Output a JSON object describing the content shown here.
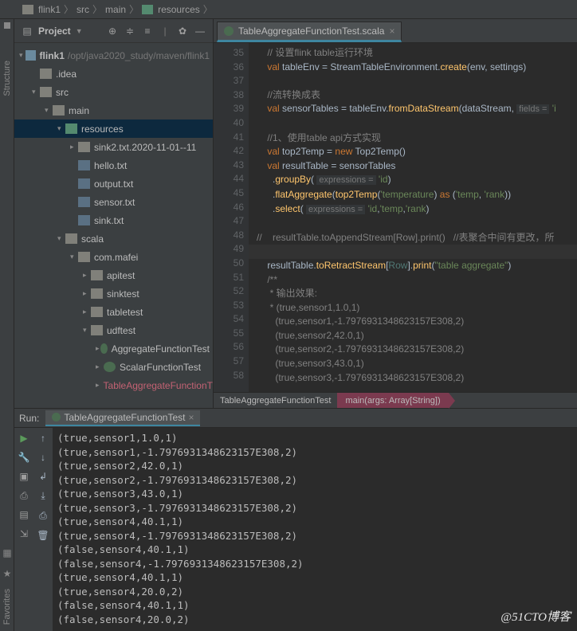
{
  "breadcrumb": [
    "flink1",
    "src",
    "main",
    "resources"
  ],
  "project": {
    "title": "Project",
    "root": {
      "label": "flink1",
      "path": "/opt/java2020_study/maven/flink1"
    },
    "tree": [
      {
        "depth": 1,
        "arrow": "",
        "icon": "dir",
        "label": ".idea"
      },
      {
        "depth": 1,
        "arrow": "▾",
        "icon": "dir",
        "label": "src"
      },
      {
        "depth": 2,
        "arrow": "▾",
        "icon": "dir",
        "label": "main"
      },
      {
        "depth": 3,
        "arrow": "▾",
        "icon": "pkg",
        "label": "resources",
        "sel": true
      },
      {
        "depth": 4,
        "arrow": "▸",
        "icon": "dir",
        "label": "sink2.txt.2020-11-01--11"
      },
      {
        "depth": 4,
        "arrow": "",
        "icon": "file",
        "label": "hello.txt"
      },
      {
        "depth": 4,
        "arrow": "",
        "icon": "file",
        "label": "output.txt"
      },
      {
        "depth": 4,
        "arrow": "",
        "icon": "file",
        "label": "sensor.txt"
      },
      {
        "depth": 4,
        "arrow": "",
        "icon": "file",
        "label": "sink.txt"
      },
      {
        "depth": 3,
        "arrow": "▾",
        "icon": "dir",
        "label": "scala"
      },
      {
        "depth": 4,
        "arrow": "▾",
        "icon": "dir",
        "label": "com.mafei"
      },
      {
        "depth": 5,
        "arrow": "▸",
        "icon": "dir",
        "label": "apitest"
      },
      {
        "depth": 5,
        "arrow": "▸",
        "icon": "dir",
        "label": "sinktest"
      },
      {
        "depth": 5,
        "arrow": "▸",
        "icon": "dir",
        "label": "tabletest"
      },
      {
        "depth": 5,
        "arrow": "▾",
        "icon": "dir",
        "label": "udftest"
      },
      {
        "depth": 6,
        "arrow": "▸",
        "icon": "cls",
        "label": "AggregateFunctionTest"
      },
      {
        "depth": 6,
        "arrow": "▸",
        "icon": "cls",
        "label": "ScalarFunctionTest"
      },
      {
        "depth": 6,
        "arrow": "▸",
        "icon": "cls",
        "label": "TableAggregateFunctionT",
        "scala": true
      }
    ]
  },
  "editor": {
    "tab": "TableAggregateFunctionTest.scala",
    "first_line": 35,
    "lines": [
      {
        "n": 35,
        "html": "<span class='cm'>// 设置flink table运行环境</span>"
      },
      {
        "n": 36,
        "html": "<span class='kw'>val</span> tableEnv = StreamTableEnvironment.<span class='fn'>create</span>(env, settings)"
      },
      {
        "n": 37,
        "html": ""
      },
      {
        "n": 38,
        "html": "<span class='cm'>//流转换成表</span>"
      },
      {
        "n": 39,
        "html": "<span class='kw'>val</span> sensorTables = tableEnv.<span class='fn'>fromDataStream</span>(dataStream, <span class='hint'>fields =</span> <span class='str'>'i</span>"
      },
      {
        "n": 40,
        "html": ""
      },
      {
        "n": 41,
        "html": "<span class='cm'>//1、使用table api方式实现</span>"
      },
      {
        "n": 42,
        "html": "<span class='kw'>val</span> top2Temp = <span class='kw'>new</span> Top2Temp()"
      },
      {
        "n": 43,
        "html": "<span class='kw'>val</span> resultTable = sensorTables"
      },
      {
        "n": 44,
        "html": "  .<span class='fn'>groupBy</span>( <span class='hint'>expressions =</span> <span class='str'>'id</span>)"
      },
      {
        "n": 45,
        "html": "  .<span class='fn'>flatAggregate</span>(<span class='fn'>top2Temp</span>(<span class='str'>'temperature</span>) <span class='kw'>as</span> (<span class='str'>'temp</span>, <span class='str'>'rank</span>))"
      },
      {
        "n": 46,
        "html": "  .<span class='fn'>select</span>( <span class='hint'>expressions =</span> <span class='str'>'id</span>,<span class='str'>'temp</span>,<span class='str'>'rank</span>)"
      },
      {
        "n": 47,
        "html": ""
      },
      {
        "n": 48,
        "html": "<span class='cm'>//    resultTable.toAppendStream[Row].print()   //表聚合中间有更改，所</span>",
        "outdent": true
      },
      {
        "n": 49,
        "html": "",
        "current": true
      },
      {
        "n": 50,
        "html": "resultTable.<span class='fn'>toRetractStream</span>[<span class='typ'>Row</span>].<span class='fn'>print</span>(<span class='str'>\"table aggregate\"</span>)"
      },
      {
        "n": 51,
        "html": "<span class='cm'>/**</span>"
      },
      {
        "n": 52,
        "html": "<span class='cm'> * 输出效果:</span>"
      },
      {
        "n": 53,
        "html": "<span class='cm'> * (true,sensor1,1.0,1)</span>"
      },
      {
        "n": 54,
        "html": "<span class='cm'>   (true,sensor1,-1.7976931348623157E308,2)</span>"
      },
      {
        "n": 55,
        "html": "<span class='cm'>   (true,sensor2,42.0,1)</span>"
      },
      {
        "n": 56,
        "html": "<span class='cm'>   (true,sensor2,-1.7976931348623157E308,2)</span>"
      },
      {
        "n": 57,
        "html": "<span class='cm'>   (true,sensor3,43.0,1)</span>"
      },
      {
        "n": 58,
        "html": "<span class='cm'>   (true,sensor3,-1.7976931348623157E308,2)</span>"
      }
    ],
    "crumb_a": "TableAggregateFunctionTest",
    "crumb_b": "main(args: Array[String])"
  },
  "run": {
    "label": "Run:",
    "tab": "TableAggregateFunctionTest",
    "output": [
      "(true,sensor1,1.0,1)",
      "(true,sensor1,-1.7976931348623157E308,2)",
      "(true,sensor2,42.0,1)",
      "(true,sensor2,-1.7976931348623157E308,2)",
      "(true,sensor3,43.0,1)",
      "(true,sensor3,-1.7976931348623157E308,2)",
      "(true,sensor4,40.1,1)",
      "(true,sensor4,-1.7976931348623157E308,2)",
      "(false,sensor4,40.1,1)",
      "(false,sensor4,-1.7976931348623157E308,2)",
      "(true,sensor4,40.1,1)",
      "(true,sensor4,20.0,2)",
      "(false,sensor4,40.1,1)",
      "(false,sensor4,20.0,2)"
    ]
  },
  "sidestrip": {
    "project": "Project",
    "structure": "Structure",
    "favorites": "Favorites"
  },
  "watermark": "@51CTO博客"
}
